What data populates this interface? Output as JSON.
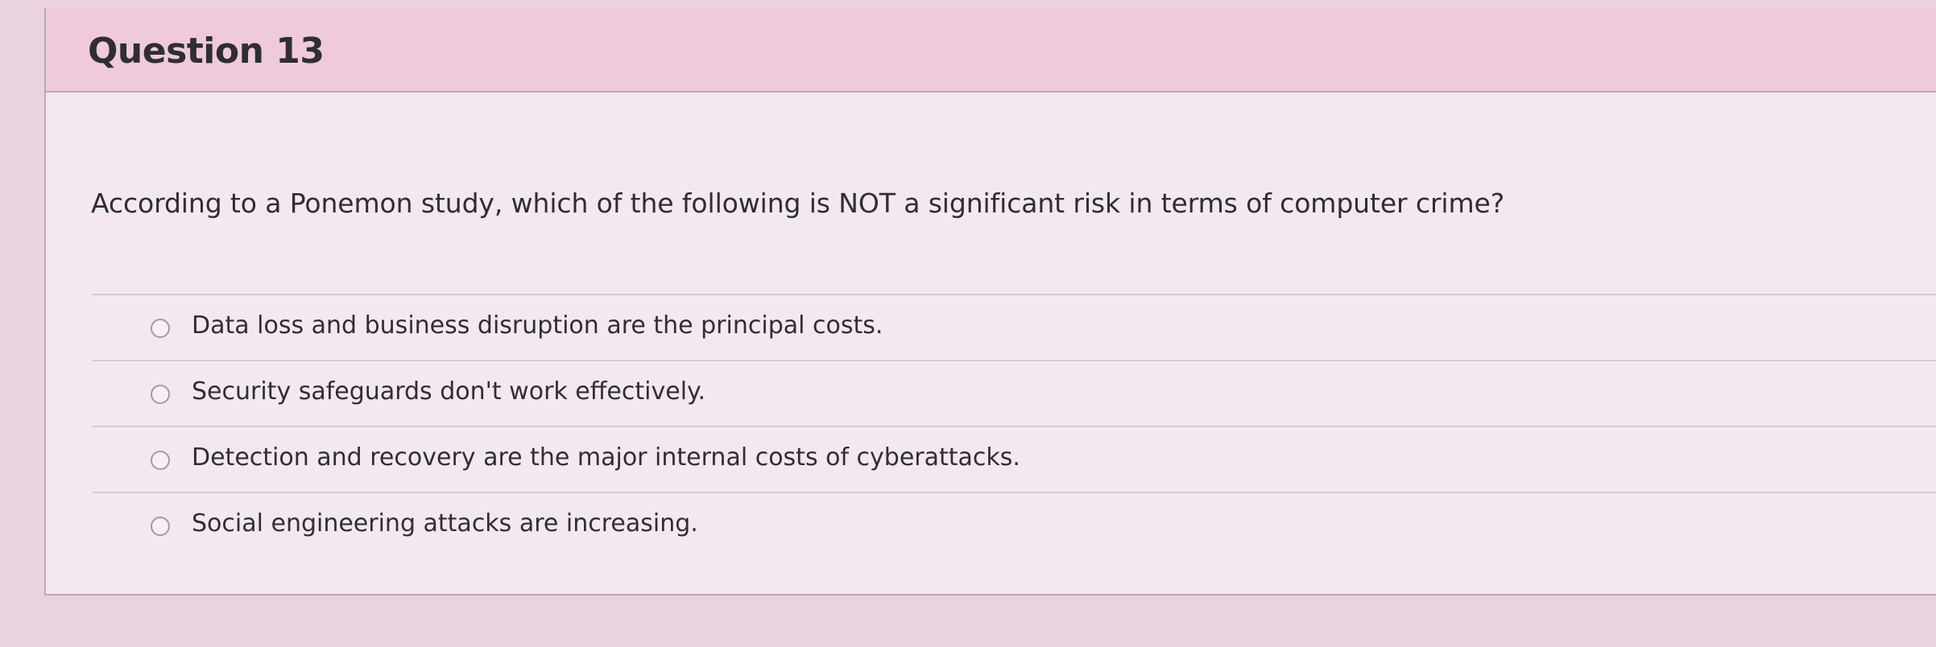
{
  "question": {
    "title": "Question 13",
    "text": "According to a Ponemon study, which of the following is NOT a significant risk in terms of computer crime?",
    "answers": [
      {
        "label": "Data loss and business disruption are the principal costs.",
        "selected": false
      },
      {
        "label": "Security safeguards don't work effectively.",
        "selected": false
      },
      {
        "label": "Detection and recovery are the major internal costs of cyberattacks.",
        "selected": false
      },
      {
        "label": "Social engineering attacks are increasing.",
        "selected": false
      }
    ]
  },
  "colors": {
    "header_background": "#eecadb",
    "card_background": "#f3e8ef",
    "text": "#2f2e31"
  }
}
